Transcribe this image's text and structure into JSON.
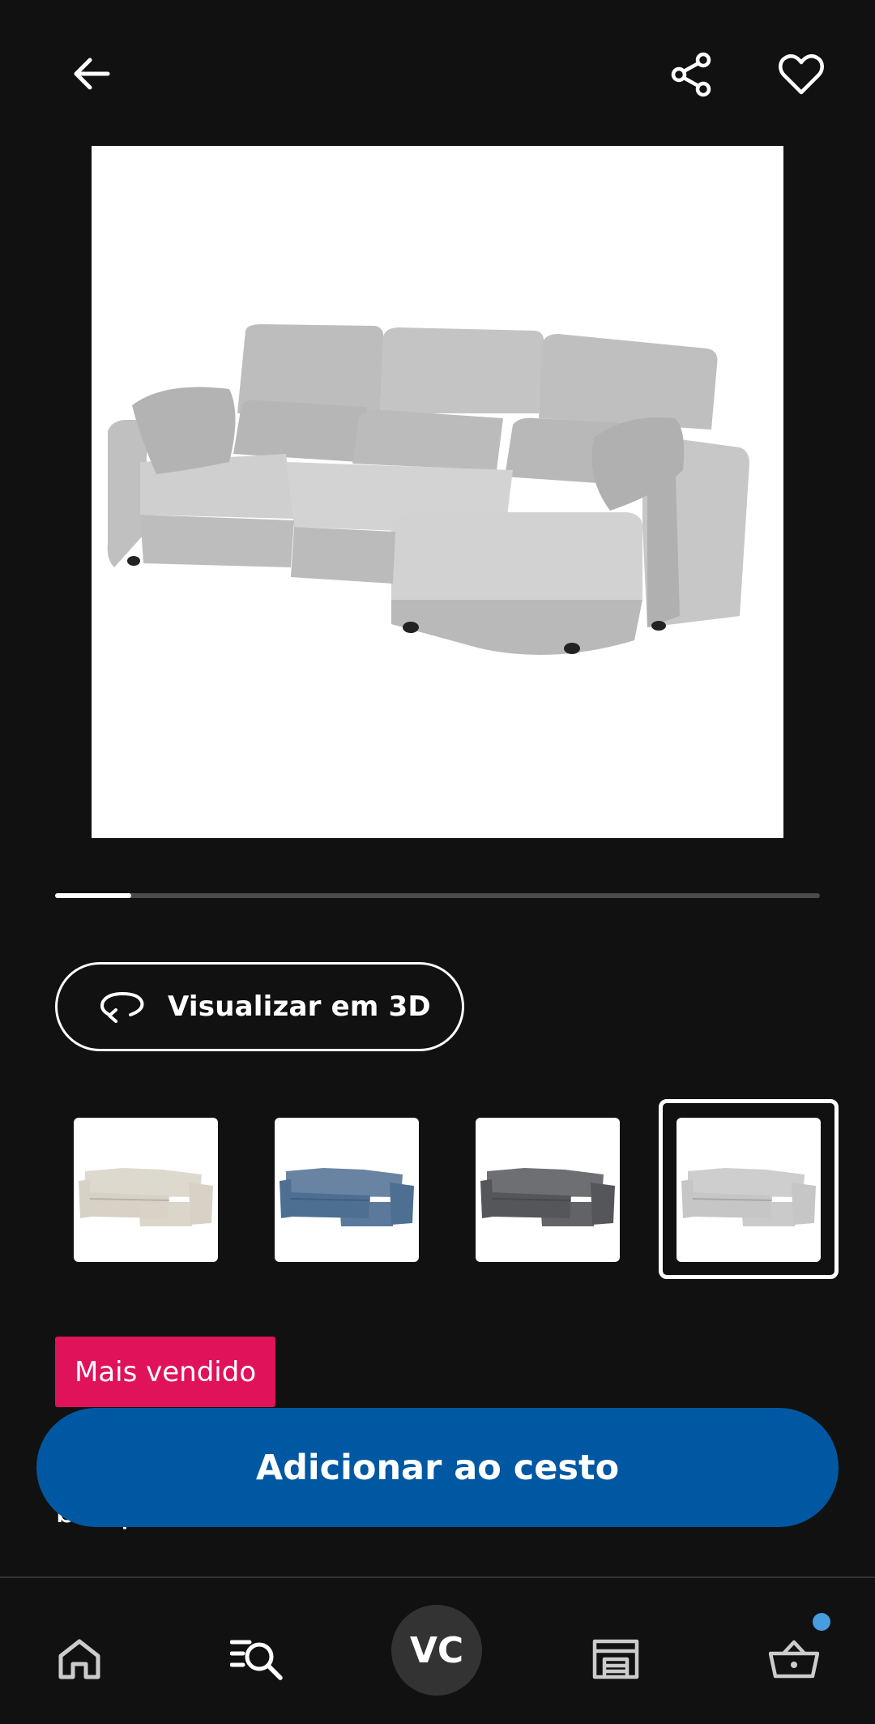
{
  "header": {
    "back_icon": "arrow-left-icon",
    "share_icon": "share-icon",
    "favorite_icon": "heart-icon"
  },
  "gallery": {
    "current_index": 1,
    "progress_fraction": 0.1
  },
  "view_3d": {
    "label": "Visualizar em 3D",
    "icon": "rotate-3d-icon"
  },
  "color_swatches": [
    {
      "color_name": "beige",
      "sofa_color": "#d8d2c6",
      "selected": false
    },
    {
      "color_name": "blue",
      "sofa_color": "#4d6f92",
      "selected": false
    },
    {
      "color_name": "dark-gray",
      "sofa_color": "#55565a",
      "selected": false
    },
    {
      "color_name": "light-gray",
      "sofa_color": "#c6c6c6",
      "selected": true
    }
  ],
  "badge": {
    "label": "Mais vendido",
    "color": "#e0125a"
  },
  "product_title_partial": {
    "line": "brc/pret"
  },
  "add_to_cart": {
    "label": "Adicionar ao cesto",
    "color": "#0058a3"
  },
  "bottom_nav": {
    "items": [
      {
        "name": "home",
        "icon": "home-icon"
      },
      {
        "name": "search",
        "icon": "search-list-icon"
      },
      {
        "name": "profile",
        "label": "VC"
      },
      {
        "name": "store",
        "icon": "store-icon"
      },
      {
        "name": "cart",
        "icon": "basket-icon",
        "has_notification": true
      }
    ],
    "notification_color": "#489ce0"
  }
}
